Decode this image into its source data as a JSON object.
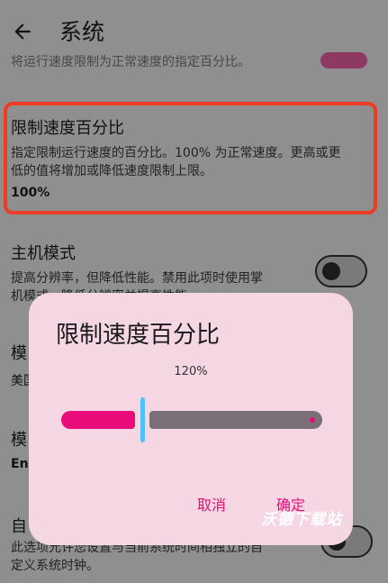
{
  "app_bar": {
    "title": "系统"
  },
  "top_partial": {
    "text": "将运行速度限制为正常速度的指定百分比。"
  },
  "speed_limit": {
    "title": "限制速度百分比",
    "desc_line1": "指定限制运行速度的百分比。100% 为正常速度。更高或更",
    "desc_line2": "低的值将增加或降低速度限制上限。",
    "value": "100%"
  },
  "host_mode": {
    "title": "主机模式",
    "desc_line1": "提高分辨率，但降低性能。禁用此项时使用掌",
    "desc_line2": "机模式，降低分辨率并提高性能。"
  },
  "behind_dialog": {
    "label1": "模",
    "label1b": "美国",
    "label2": "模",
    "label2b": "En"
  },
  "custom_clock": {
    "title_fragment": "自",
    "desc_line1": "此选项允许您设置与当前系统时间相独立的自",
    "desc_line2": "定义系统时钟。"
  },
  "dialog": {
    "title": "限制速度百分比",
    "value_text": "120%",
    "slider_fraction": 0.28,
    "cancel": "取消",
    "confirm": "确定"
  },
  "watermark": "沃德下载站",
  "colors": {
    "accent": "#e90b79",
    "thumb": "#4fc3f7",
    "highlight_border": "#ee3b24"
  }
}
